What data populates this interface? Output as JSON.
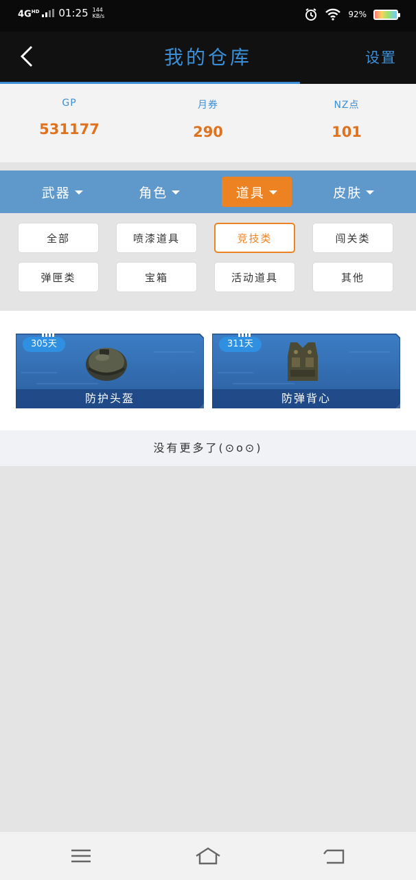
{
  "status_bar": {
    "network": "4G",
    "network_sup": "HD",
    "time": "01:25",
    "speed_value": "144",
    "speed_unit": "KB/s",
    "battery": "92%"
  },
  "header": {
    "title": "我的仓库",
    "settings": "设置",
    "back_icon": "chevron-left-icon"
  },
  "stats": [
    {
      "label": "GP",
      "value": "531177"
    },
    {
      "label": "月券",
      "value": "290"
    },
    {
      "label": "NZ点",
      "value": "101"
    }
  ],
  "categories": [
    {
      "label": "武器",
      "active": false
    },
    {
      "label": "角色",
      "active": false
    },
    {
      "label": "道具",
      "active": true
    },
    {
      "label": "皮肤",
      "active": false
    }
  ],
  "filters": [
    {
      "label": "全部",
      "active": false
    },
    {
      "label": "喷漆道具",
      "active": false
    },
    {
      "label": "竞技类",
      "active": true
    },
    {
      "label": "闯关类",
      "active": false
    },
    {
      "label": "弹匣类",
      "active": false
    },
    {
      "label": "宝箱",
      "active": false
    },
    {
      "label": "活动道具",
      "active": false
    },
    {
      "label": "其他",
      "active": false
    }
  ],
  "items": [
    {
      "days": "305天",
      "name": "防护头盔",
      "icon": "helmet-icon"
    },
    {
      "days": "311天",
      "name": "防弹背心",
      "icon": "vest-icon"
    }
  ],
  "no_more": "没有更多了(⊙o⊙)",
  "nav": [
    "menu-icon",
    "home-icon",
    "back-icon"
  ],
  "colors": {
    "accent_blue": "#3b8fd6",
    "accent_orange": "#ec8222",
    "category_bar": "#5f98cb"
  }
}
